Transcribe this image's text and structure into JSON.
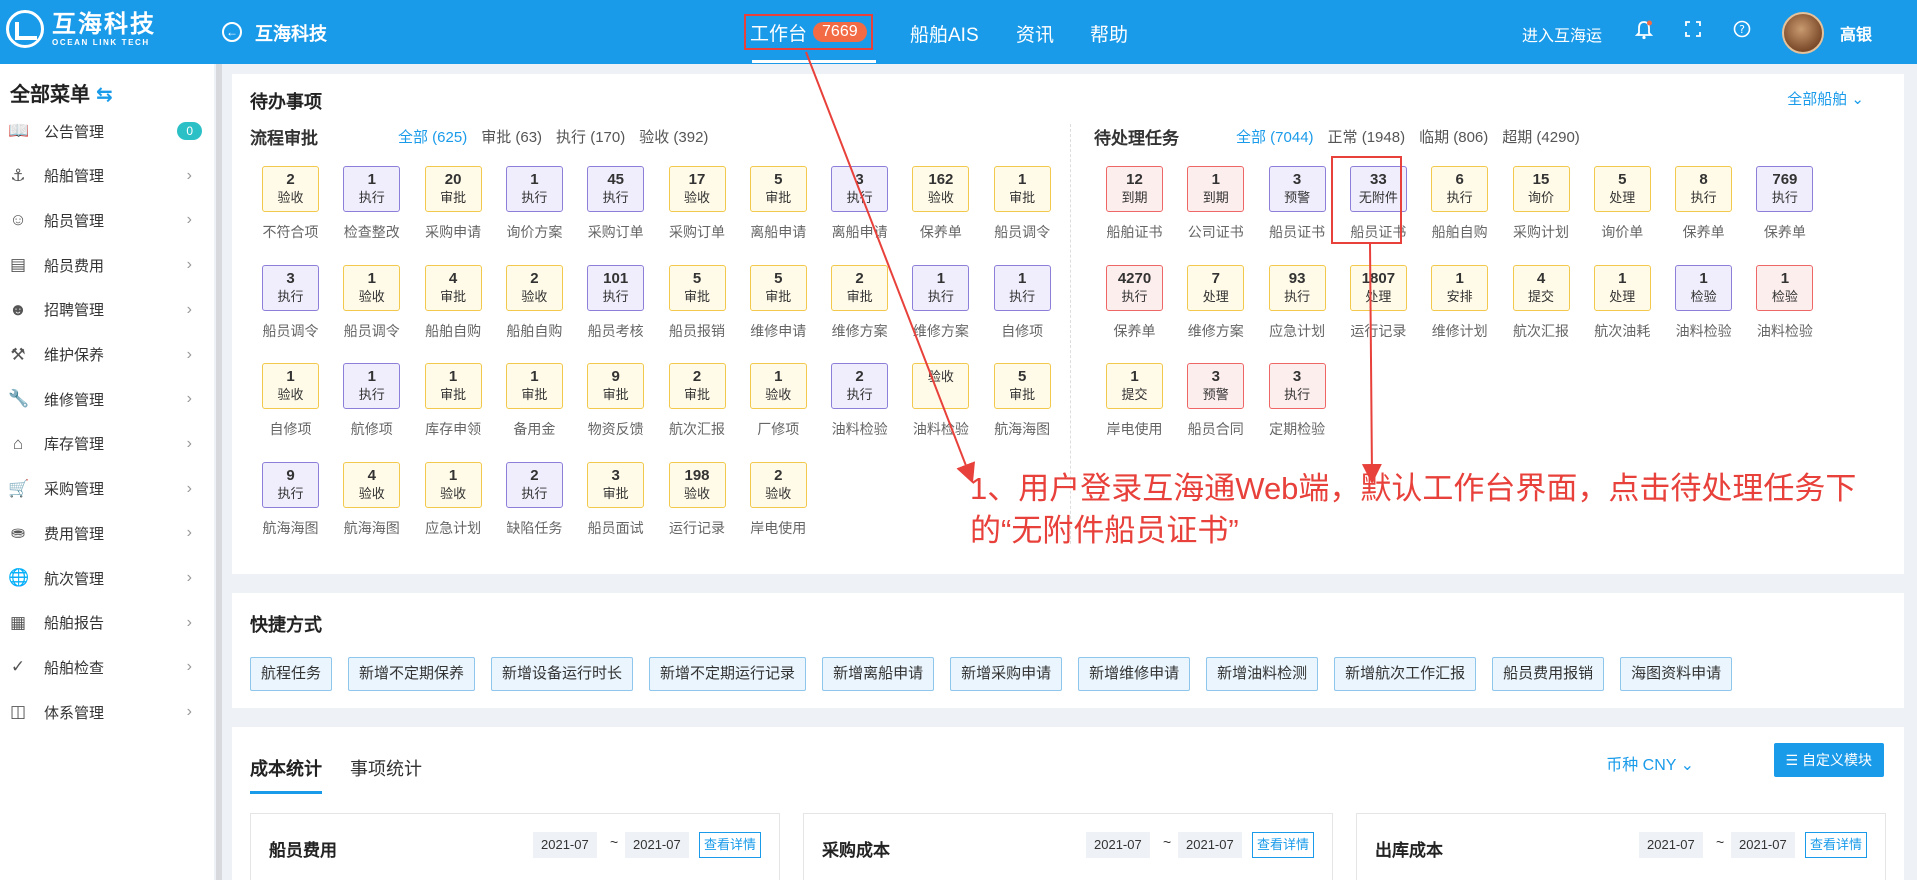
{
  "brand": {
    "name_cn": "互海科技",
    "name_en": "OCEAN LINK TECH"
  },
  "header": {
    "company": "互海科技",
    "nav_work": "工作台",
    "nav_work_count": "7669",
    "nav_ais": "船舶AIS",
    "nav_news": "资讯",
    "nav_help": "帮助",
    "enter_link": "进入互海运",
    "user_name": "高银"
  },
  "sidebar": {
    "title": "全部菜单",
    "items": [
      {
        "label": "公告管理",
        "icon": "book-icon",
        "badge": "0"
      },
      {
        "label": "船舶管理",
        "icon": "anchor-icon"
      },
      {
        "label": "船员管理",
        "icon": "user-icon"
      },
      {
        "label": "船员费用",
        "icon": "wallet-icon"
      },
      {
        "label": "招聘管理",
        "icon": "recruit-icon"
      },
      {
        "label": "维护保养",
        "icon": "hammer-icon"
      },
      {
        "label": "维修管理",
        "icon": "wrench-icon"
      },
      {
        "label": "库存管理",
        "icon": "warehouse-icon"
      },
      {
        "label": "采购管理",
        "icon": "cart-icon"
      },
      {
        "label": "费用管理",
        "icon": "coins-icon"
      },
      {
        "label": "航次管理",
        "icon": "globe-icon"
      },
      {
        "label": "船舶报告",
        "icon": "calendar-icon"
      },
      {
        "label": "船舶检查",
        "icon": "check-circle-icon"
      },
      {
        "label": "体系管理",
        "icon": "docs-icon"
      }
    ]
  },
  "todo": {
    "title": "待办事项",
    "all_ships": "全部船舶",
    "flow": {
      "title": "流程审批",
      "filters": [
        "全部 (625)",
        "审批 (63)",
        "执行 (170)",
        "验收 (392)"
      ],
      "tiles": [
        {
          "n": "2",
          "s": "验收",
          "l": "不符合项",
          "c": "yellow"
        },
        {
          "n": "1",
          "s": "执行",
          "l": "检查整改",
          "c": "purple"
        },
        {
          "n": "20",
          "s": "审批",
          "l": "采购申请",
          "c": "yellow"
        },
        {
          "n": "1",
          "s": "执行",
          "l": "询价方案",
          "c": "purple"
        },
        {
          "n": "45",
          "s": "执行",
          "l": "采购订单",
          "c": "purple"
        },
        {
          "n": "17",
          "s": "验收",
          "l": "采购订单",
          "c": "yellow"
        },
        {
          "n": "5",
          "s": "审批",
          "l": "离船申请",
          "c": "yellow"
        },
        {
          "n": "3",
          "s": "执行",
          "l": "离船申请",
          "c": "purple"
        },
        {
          "n": "162",
          "s": "验收",
          "l": "保养单",
          "c": "yellow"
        },
        {
          "n": "1",
          "s": "审批",
          "l": "船员调令",
          "c": "yellow"
        },
        {
          "n": "3",
          "s": "执行",
          "l": "船员调令",
          "c": "purple"
        },
        {
          "n": "1",
          "s": "验收",
          "l": "船员调令",
          "c": "yellow"
        },
        {
          "n": "4",
          "s": "审批",
          "l": "船舶自购",
          "c": "yellow"
        },
        {
          "n": "2",
          "s": "验收",
          "l": "船舶自购",
          "c": "yellow"
        },
        {
          "n": "101",
          "s": "执行",
          "l": "船员考核",
          "c": "purple"
        },
        {
          "n": "5",
          "s": "审批",
          "l": "船员报销",
          "c": "yellow"
        },
        {
          "n": "5",
          "s": "审批",
          "l": "维修申请",
          "c": "yellow"
        },
        {
          "n": "2",
          "s": "审批",
          "l": "维修方案",
          "c": "yellow"
        },
        {
          "n": "1",
          "s": "执行",
          "l": "维修方案",
          "c": "purple"
        },
        {
          "n": "1",
          "s": "执行",
          "l": "自修项",
          "c": "purple"
        },
        {
          "n": "1",
          "s": "验收",
          "l": "自修项",
          "c": "yellow"
        },
        {
          "n": "1",
          "s": "执行",
          "l": "航修项",
          "c": "purple"
        },
        {
          "n": "1",
          "s": "审批",
          "l": "库存申领",
          "c": "yellow"
        },
        {
          "n": "1",
          "s": "审批",
          "l": "备用金",
          "c": "yellow"
        },
        {
          "n": "9",
          "s": "审批",
          "l": "物资反馈",
          "c": "yellow"
        },
        {
          "n": "2",
          "s": "审批",
          "l": "航次汇报",
          "c": "yellow"
        },
        {
          "n": "1",
          "s": "验收",
          "l": "厂修项",
          "c": "yellow"
        },
        {
          "n": "2",
          "s": "执行",
          "l": "油料检验",
          "c": "purple"
        },
        {
          "n": "",
          "s": "验收",
          "l": "油料检验",
          "c": "yellow"
        },
        {
          "n": "5",
          "s": "审批",
          "l": "航海海图",
          "c": "yellow"
        },
        {
          "n": "9",
          "s": "执行",
          "l": "航海海图",
          "c": "purple"
        },
        {
          "n": "4",
          "s": "验收",
          "l": "航海海图",
          "c": "yellow"
        },
        {
          "n": "1",
          "s": "验收",
          "l": "应急计划",
          "c": "yellow"
        },
        {
          "n": "2",
          "s": "执行",
          "l": "缺陷任务",
          "c": "purple"
        },
        {
          "n": "3",
          "s": "审批",
          "l": "船员面试",
          "c": "yellow"
        },
        {
          "n": "198",
          "s": "验收",
          "l": "运行记录",
          "c": "yellow"
        },
        {
          "n": "2",
          "s": "验收",
          "l": "岸电使用",
          "c": "yellow"
        }
      ]
    },
    "pending": {
      "title": "待处理任务",
      "filters": [
        "全部 (7044)",
        "正常 (1948)",
        "临期 (806)",
        "超期 (4290)"
      ],
      "tiles": [
        {
          "n": "12",
          "s": "到期",
          "l": "船舶证书",
          "c": "red"
        },
        {
          "n": "1",
          "s": "到期",
          "l": "公司证书",
          "c": "red"
        },
        {
          "n": "3",
          "s": "预警",
          "l": "船员证书",
          "c": "purple"
        },
        {
          "n": "33",
          "s": "无附件",
          "l": "船员证书",
          "c": "purple"
        },
        {
          "n": "6",
          "s": "执行",
          "l": "船舶自购",
          "c": "yellow"
        },
        {
          "n": "15",
          "s": "询价",
          "l": "采购计划",
          "c": "yellow"
        },
        {
          "n": "5",
          "s": "处理",
          "l": "询价单",
          "c": "yellow"
        },
        {
          "n": "8",
          "s": "执行",
          "l": "保养单",
          "c": "yellow"
        },
        {
          "n": "769",
          "s": "执行",
          "l": "保养单",
          "c": "purple"
        },
        {
          "n": "4270",
          "s": "执行",
          "l": "保养单",
          "c": "red"
        },
        {
          "n": "7",
          "s": "处理",
          "l": "维修方案",
          "c": "yellow"
        },
        {
          "n": "93",
          "s": "执行",
          "l": "应急计划",
          "c": "yellow"
        },
        {
          "n": "1807",
          "s": "处理",
          "l": "运行记录",
          "c": "yellow"
        },
        {
          "n": "1",
          "s": "安排",
          "l": "维修计划",
          "c": "yellow"
        },
        {
          "n": "4",
          "s": "提交",
          "l": "航次汇报",
          "c": "yellow"
        },
        {
          "n": "1",
          "s": "处理",
          "l": "航次油耗",
          "c": "yellow"
        },
        {
          "n": "1",
          "s": "检验",
          "l": "油料检验",
          "c": "purple"
        },
        {
          "n": "1",
          "s": "检验",
          "l": "油料检验",
          "c": "red"
        },
        {
          "n": "1",
          "s": "提交",
          "l": "岸电使用",
          "c": "yellow"
        },
        {
          "n": "3",
          "s": "预警",
          "l": "船员合同",
          "c": "red"
        },
        {
          "n": "3",
          "s": "执行",
          "l": "定期检验",
          "c": "red"
        }
      ]
    }
  },
  "annotation": {
    "text": "1、用户登录互海通Web端，默认工作台界面，点击待处理任务下的“无附件船员证书”"
  },
  "quick": {
    "title": "快捷方式",
    "buttons": [
      "航程任务",
      "新增不定期保养",
      "新增设备运行时长",
      "新增不定期运行记录",
      "新增离船申请",
      "新增采购申请",
      "新增维修申请",
      "新增油料检测",
      "新增航次工作汇报",
      "船员费用报销",
      "海图资料申请"
    ]
  },
  "cost": {
    "tab_cost": "成本统计",
    "tab_items": "事项统计",
    "currency": "币种 CNY",
    "custom": "自定义模块",
    "cards": [
      {
        "title": "船员费用",
        "from": "2021-07",
        "to": "2021-07",
        "detail": "查看详情"
      },
      {
        "title": "采购成本",
        "from": "2021-07",
        "to": "2021-07",
        "detail": "查看详情"
      },
      {
        "title": "出库成本",
        "from": "2021-07",
        "to": "2021-07",
        "detail": "查看详情"
      }
    ]
  },
  "colors": {
    "primary": "#1a9bea",
    "annotation": "#e8403a",
    "tile_yellow": "#f2c94c",
    "tile_purple": "#8c7fd9",
    "tile_red": "#e66666"
  }
}
